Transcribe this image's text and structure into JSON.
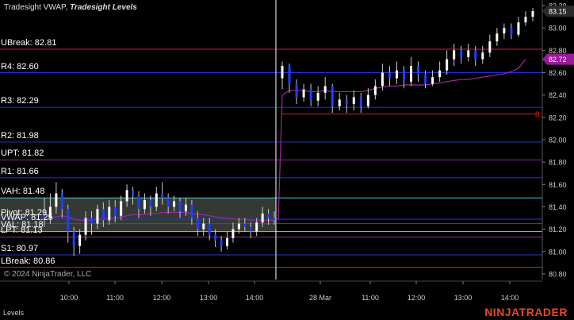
{
  "header": {
    "indicator": "Tradesight VWAP,",
    "indicator2": "Tradesight Levels"
  },
  "footer": {
    "copyright": "© 2024 NinjaTrader, LLC",
    "panel": "Levels",
    "brand": "NINJATRADER"
  },
  "chart_data": {
    "type": "candlestick",
    "ylim": [
      80.75,
      83.25
    ],
    "grid": false,
    "x_ticks": [
      "10:00",
      "11:00",
      "12:00",
      "13:00",
      "14:00",
      "28 Mar",
      "11:00",
      "12:00",
      "13:00",
      "14:00"
    ],
    "y_ticks": [
      "83.20",
      "83.00",
      "82.80",
      "82.60",
      "82.40",
      "82.20",
      "82.00",
      "81.80",
      "81.60",
      "81.40",
      "81.20",
      "81.00",
      "80.80"
    ],
    "levels": [
      {
        "name": "UBreak",
        "label": "UBreak: 82.81",
        "value": 82.81,
        "color": "#c0263a"
      },
      {
        "name": "R4",
        "label": "R4: 82.60",
        "value": 82.6,
        "color": "#2233d6"
      },
      {
        "name": "R3",
        "label": "R3: 82.29",
        "value": 82.29,
        "color": "#2233d6"
      },
      {
        "name": "R2",
        "label": "R2: 81.98",
        "value": 81.98,
        "color": "#2233d6"
      },
      {
        "name": "UPT",
        "label": "UPT: 81.82",
        "value": 81.82,
        "color": "#8a2a8a"
      },
      {
        "name": "R1",
        "label": "R1: 81.66",
        "value": 81.66,
        "color": "#2233d6"
      },
      {
        "name": "VAH",
        "label": "VAH: 81.48",
        "value": 81.48,
        "color": "#3fd0d0"
      },
      {
        "name": "Pivot",
        "label": "Pivot: 81.29",
        "value": 81.29,
        "color": "#2233d6"
      },
      {
        "name": "VWAP",
        "label": "VWAP: 81.25",
        "value": 81.25,
        "color": "#8a2a8a"
      },
      {
        "name": "VAL",
        "label": "VAL: 81.18",
        "value": 81.18,
        "color": "#3fd0d0"
      },
      {
        "name": "LPT",
        "label": "LPT: 81.13",
        "value": 81.13,
        "color": "#8a2a8a"
      },
      {
        "name": "S1",
        "label": "S1: 80.97",
        "value": 80.97,
        "color": "#2233d6"
      },
      {
        "name": "LBreak",
        "label": "LBreak: 80.86",
        "value": 80.86,
        "color": "#c0263a"
      }
    ],
    "value_area": [
      81.18,
      81.48
    ],
    "session_break_index": 40,
    "day2_level": {
      "value": 82.23,
      "color": "#c0263a",
      "label": "8."
    },
    "last_price": {
      "value": 83.15,
      "label": "83.15"
    },
    "vwap_last": {
      "value": 82.72,
      "label": "82.72"
    },
    "candles": [
      [
        81.35,
        81.3,
        81.48,
        81.22
      ],
      [
        81.3,
        81.4,
        81.52,
        81.25
      ],
      [
        81.4,
        81.52,
        81.62,
        81.34
      ],
      [
        81.52,
        81.38,
        81.56,
        81.3
      ],
      [
        81.38,
        81.18,
        81.42,
        81.08
      ],
      [
        81.18,
        81.05,
        81.22,
        80.96
      ],
      [
        81.05,
        81.15,
        81.2,
        80.98
      ],
      [
        81.15,
        81.3,
        81.36,
        81.1
      ],
      [
        81.3,
        81.25,
        81.36,
        81.15
      ],
      [
        81.25,
        81.38,
        81.42,
        81.2
      ],
      [
        81.38,
        81.28,
        81.44,
        81.22
      ],
      [
        81.28,
        81.4,
        81.46,
        81.24
      ],
      [
        81.4,
        81.32,
        81.46,
        81.26
      ],
      [
        81.32,
        81.45,
        81.5,
        81.28
      ],
      [
        81.45,
        81.55,
        81.6,
        81.4
      ],
      [
        81.55,
        81.5,
        81.58,
        81.42
      ],
      [
        81.5,
        81.38,
        81.54,
        81.3
      ],
      [
        81.38,
        81.46,
        81.52,
        81.34
      ],
      [
        81.46,
        81.4,
        81.5,
        81.32
      ],
      [
        81.4,
        81.52,
        81.58,
        81.36
      ],
      [
        81.52,
        81.48,
        81.62,
        81.42
      ],
      [
        81.48,
        81.4,
        81.52,
        81.34
      ],
      [
        81.4,
        81.45,
        81.5,
        81.36
      ],
      [
        81.45,
        81.36,
        81.48,
        81.3
      ],
      [
        81.36,
        81.42,
        81.48,
        81.32
      ],
      [
        81.42,
        81.3,
        81.46,
        81.24
      ],
      [
        81.3,
        81.2,
        81.36,
        81.14
      ],
      [
        81.2,
        81.25,
        81.3,
        81.14
      ],
      [
        81.25,
        81.15,
        81.3,
        81.1
      ],
      [
        81.15,
        81.1,
        81.2,
        81.04
      ],
      [
        81.1,
        81.05,
        81.14,
        81.0
      ],
      [
        81.05,
        81.12,
        81.18,
        81.02
      ],
      [
        81.12,
        81.2,
        81.26,
        81.08
      ],
      [
        81.2,
        81.25,
        81.3,
        81.16
      ],
      [
        81.25,
        81.22,
        81.3,
        81.18
      ],
      [
        81.22,
        81.18,
        81.26,
        81.12
      ],
      [
        81.18,
        81.26,
        81.3,
        81.14
      ],
      [
        81.26,
        81.34,
        81.4,
        81.22
      ],
      [
        81.34,
        81.3,
        81.38,
        81.24
      ],
      [
        81.3,
        81.28,
        81.36,
        81.24
      ],
      [
        82.55,
        82.66,
        82.7,
        82.45
      ],
      [
        82.66,
        82.5,
        82.68,
        82.42
      ],
      [
        82.5,
        82.38,
        82.54,
        82.32
      ],
      [
        82.38,
        82.45,
        82.5,
        82.34
      ],
      [
        82.45,
        82.35,
        82.5,
        82.3
      ],
      [
        82.35,
        82.42,
        82.48,
        82.3
      ],
      [
        82.42,
        82.48,
        82.56,
        82.36
      ],
      [
        82.48,
        82.3,
        82.5,
        82.24
      ],
      [
        82.3,
        82.36,
        82.42,
        82.26
      ],
      [
        82.36,
        82.32,
        82.4,
        82.24
      ],
      [
        82.32,
        82.38,
        82.44,
        82.26
      ],
      [
        82.38,
        82.3,
        82.42,
        82.24
      ],
      [
        82.3,
        82.4,
        82.46,
        82.28
      ],
      [
        82.4,
        82.48,
        82.54,
        82.36
      ],
      [
        82.48,
        82.6,
        82.68,
        82.44
      ],
      [
        82.6,
        82.55,
        82.66,
        82.48
      ],
      [
        82.55,
        82.62,
        82.7,
        82.5
      ],
      [
        82.62,
        82.52,
        82.66,
        82.46
      ],
      [
        82.52,
        82.66,
        82.74,
        82.48
      ],
      [
        82.66,
        82.58,
        82.7,
        82.52
      ],
      [
        82.58,
        82.5,
        82.62,
        82.46
      ],
      [
        82.5,
        82.56,
        82.62,
        82.48
      ],
      [
        82.56,
        82.62,
        82.7,
        82.52
      ],
      [
        82.62,
        82.72,
        82.8,
        82.58
      ],
      [
        82.72,
        82.8,
        82.86,
        82.66
      ],
      [
        82.8,
        82.74,
        82.84,
        82.68
      ],
      [
        82.74,
        82.8,
        82.86,
        82.7
      ],
      [
        82.8,
        82.72,
        82.84,
        82.66
      ],
      [
        82.72,
        82.78,
        82.84,
        82.68
      ],
      [
        82.78,
        82.88,
        82.94,
        82.74
      ],
      [
        82.88,
        82.95,
        83.0,
        82.84
      ],
      [
        82.95,
        83.0,
        83.04,
        82.9
      ],
      [
        83.0,
        82.94,
        83.04,
        82.9
      ],
      [
        82.94,
        83.05,
        83.1,
        82.92
      ],
      [
        83.05,
        83.1,
        83.15,
        83.02
      ],
      [
        83.1,
        83.15,
        83.18,
        83.06
      ]
    ],
    "vwap_day1": [
      81.29,
      81.3,
      81.31,
      81.32,
      81.31,
      81.29,
      81.28,
      81.28,
      81.28,
      81.29,
      81.29,
      81.3,
      81.3,
      81.31,
      81.32,
      81.33,
      81.33,
      81.33,
      81.34,
      81.34,
      81.35,
      81.35,
      81.35,
      81.35,
      81.35,
      81.34,
      81.33,
      81.33,
      81.32,
      81.31,
      81.3,
      81.3,
      81.29,
      81.29,
      81.29,
      81.28,
      81.28,
      81.28,
      81.28,
      81.28
    ],
    "vwap_day2": [
      81.28,
      82.4,
      82.44,
      82.44,
      82.44,
      82.43,
      82.43,
      82.44,
      82.43,
      82.43,
      82.43,
      82.43,
      82.43,
      82.44,
      82.46,
      82.47,
      82.48,
      82.48,
      82.49,
      82.49,
      82.49,
      82.49,
      82.5,
      82.51,
      82.52,
      82.53,
      82.54,
      82.54,
      82.55,
      82.56,
      82.57,
      82.58,
      82.59,
      82.61,
      82.64,
      82.72
    ]
  }
}
